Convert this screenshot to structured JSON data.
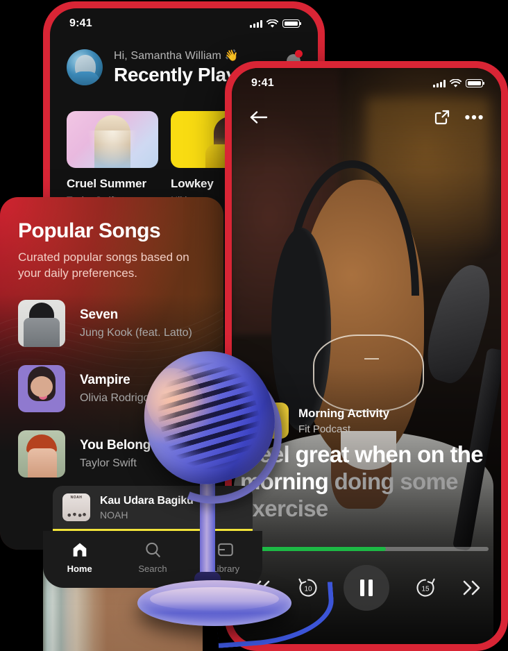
{
  "phone_music": {
    "status": {
      "time": "9:41",
      "signal_icon": "cellular-bars-icon",
      "wifi_icon": "wifi-icon",
      "battery_icon": "battery-icon"
    },
    "greeting": "Hi, Samantha William",
    "greeting_emoji": "👋",
    "title": "Recently Played",
    "notification_icon": "bell-icon",
    "cards": [
      {
        "title": "Cruel Summer",
        "artist": "Taylor Swift"
      },
      {
        "title": "Lowkey",
        "artist": "Niki"
      }
    ]
  },
  "popular_panel": {
    "title": "Popular Songs",
    "subtitle": "Curated popular songs based on your daily preferences.",
    "songs": [
      {
        "title": "Seven",
        "artist": "Jung Kook (feat. Latto)"
      },
      {
        "title": "Vampire",
        "artist": "Olivia Rodrigo"
      },
      {
        "title": "You Belong",
        "artist": "Taylor Swift"
      }
    ]
  },
  "mini_player": {
    "title": "Kau Udara Bagiku",
    "artist": "NOAH",
    "accent_color": "#f2e33a"
  },
  "tab_bar": {
    "items": [
      {
        "label": "Home",
        "icon": "home-icon",
        "active": true
      },
      {
        "label": "Search",
        "icon": "search-icon",
        "active": false
      },
      {
        "label": "Library",
        "icon": "library-icon",
        "active": false
      }
    ]
  },
  "phone_podcast": {
    "status": {
      "time": "9:41",
      "signal_icon": "cellular-bars-icon",
      "wifi_icon": "wifi-icon",
      "battery_icon": "battery-icon"
    },
    "nav": {
      "back_icon": "arrow-left-icon",
      "share_icon": "share-icon",
      "more_icon": "more-dots-icon"
    },
    "episode_title": "Morning Activity",
    "show_name": "Fit Podcast",
    "lyrics_spoken": "I feel great when on the morning ",
    "lyrics_upcoming": "doing some exercise",
    "progress": {
      "percent": 58,
      "fill_color": "#1db945"
    },
    "controls": {
      "previous": "previous-track-icon",
      "rewind": "rewind-10-icon",
      "rewind_label": "10",
      "play_pause": "pause-icon",
      "forward": "forward-15-icon",
      "forward_label": "15",
      "next": "next-track-icon"
    }
  },
  "theme": {
    "frame_red": "#d92535",
    "panel_gradient_start": "#cf2230",
    "panel_gradient_end": "#eb943c",
    "dark_bg": "#121212"
  }
}
